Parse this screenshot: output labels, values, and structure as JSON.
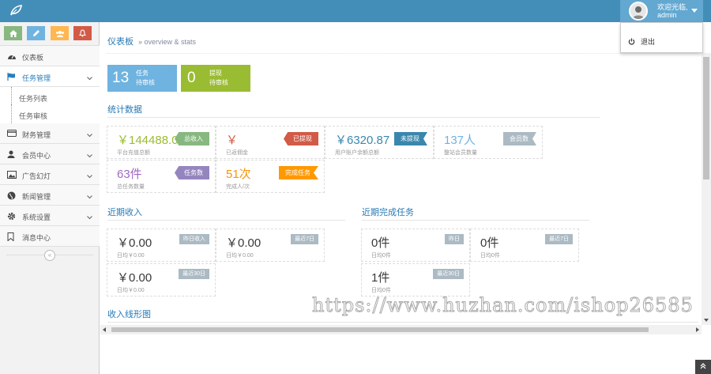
{
  "header": {
    "user_greeting": "欢迎光临,",
    "user_name": "admin",
    "dropdown_logout": "退出"
  },
  "sidebar": {
    "items": [
      {
        "label": "仪表板",
        "icon": "dashboard-icon"
      },
      {
        "label": "任务管理",
        "icon": "flag-icon",
        "active": true
      },
      {
        "label": "财务管理",
        "icon": "credit-card-icon"
      },
      {
        "label": "会员中心",
        "icon": "user-icon"
      },
      {
        "label": "广告幻灯",
        "icon": "picture-icon"
      },
      {
        "label": "新闻管理",
        "icon": "globe-icon"
      },
      {
        "label": "系统设置",
        "icon": "cog-icon"
      },
      {
        "label": "消息中心",
        "icon": "bookmark-icon"
      }
    ],
    "submenu": [
      "任务列表",
      "任务审核"
    ],
    "collapse_icon": "«"
  },
  "breadcrumb": {
    "title": "仪表板",
    "subtitle": "» overview & stats"
  },
  "infoboxes": [
    {
      "num": "13",
      "line1": "任务",
      "line2": "待审核",
      "color": "#6fb3e0"
    },
    {
      "num": "0",
      "line1": "提现",
      "line2": "待审核",
      "color": "#9abc32"
    }
  ],
  "stats": {
    "title": "统计数据",
    "cards": [
      {
        "value": "￥144488.0",
        "sub": "平台充值总额",
        "tag": "总收入",
        "tag_color": "#87b87f",
        "value_color": "#9abc32"
      },
      {
        "value": "￥",
        "sub": "已返佣金",
        "tag": "已提现",
        "tag_color": "#d15b47",
        "value_color": "#d15b47"
      },
      {
        "value": "￥6320.87",
        "sub": "用户账户余额总额",
        "tag": "未提现",
        "tag_color": "#3a87ad",
        "value_color": "#3a87ad"
      },
      {
        "value": "137人",
        "sub": "整站会员数量",
        "tag": "会员数",
        "tag_color": "#abbac3",
        "value_color": "#6fb3e0"
      },
      {
        "value": "63件",
        "sub": "总任务数量",
        "tag": "任务数",
        "tag_color": "#9585bf",
        "value_color": "#a069c3"
      },
      {
        "value": "51次",
        "sub": "完成人/次",
        "tag": "完成任务",
        "tag_color": "#ff9900",
        "value_color": "#f89406"
      }
    ]
  },
  "income": {
    "title": "近期收入",
    "cards": [
      {
        "value": "￥0.00",
        "sub": "日均￥0.00",
        "tag": "昨日收入"
      },
      {
        "value": "￥0.00",
        "sub": "日均￥0.00",
        "tag": "最近7日"
      },
      {
        "value": "￥0.00",
        "sub": "日均￥0.00",
        "tag": "最近30日"
      }
    ]
  },
  "tasks": {
    "title": "近期完成任务",
    "cards": [
      {
        "value": "0件",
        "sub": "日均0件",
        "tag": "昨日"
      },
      {
        "value": "0件",
        "sub": "日均0件",
        "tag": "最近7日"
      },
      {
        "value": "1件",
        "sub": "日均0件",
        "tag": "最近30日"
      }
    ]
  },
  "line_chart_title": "收入线形图",
  "watermark": "https://www.huzhan.com/ishop26585"
}
